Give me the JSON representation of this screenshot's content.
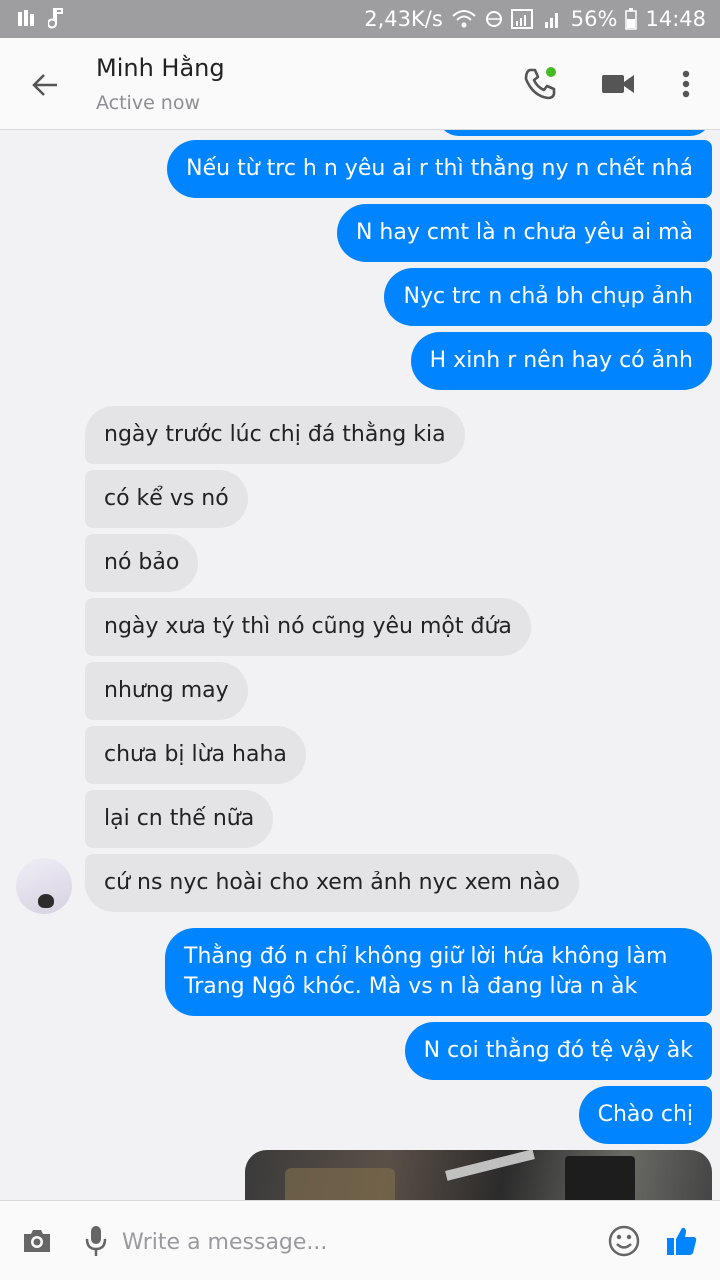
{
  "status_bar": {
    "speed": "2,43K/s",
    "battery": "56%",
    "time": "14:48"
  },
  "header": {
    "contact_name": "Minh Hằng",
    "contact_status": "Active now",
    "icons": [
      "back-arrow-icon",
      "phone-icon",
      "video-camera-icon",
      "more-vertical-icon"
    ]
  },
  "messages": [
    {
      "side": "out",
      "text": "Nếu từ trc h n yêu ai r thì thằng ny n chết nhá"
    },
    {
      "side": "out",
      "text": "N hay cmt là n chưa yêu ai mà"
    },
    {
      "side": "out",
      "text": "Nyc trc n chả bh chụp ảnh"
    },
    {
      "side": "out",
      "text": "H xinh r nên hay có ảnh"
    },
    {
      "side": "in",
      "text": "ngày trước lúc chị đá thằng kia"
    },
    {
      "side": "in",
      "text": "có kể vs nó"
    },
    {
      "side": "in",
      "text": "nó bảo"
    },
    {
      "side": "in",
      "text": "ngày xưa tý thì nó cũng yêu một đứa"
    },
    {
      "side": "in",
      "text": "nhưng may"
    },
    {
      "side": "in",
      "text": "chưa bị lừa haha"
    },
    {
      "side": "in",
      "text": "lại cn thế nữa"
    },
    {
      "side": "in",
      "text": "cứ ns nyc hoài cho xem ảnh nyc xem nào"
    },
    {
      "side": "out",
      "line1": "Thằng đó n chỉ không giữ lời hứa không làm",
      "line2": "Trang Ngô khóc. Mà vs n là đang lừa n àk"
    },
    {
      "side": "out",
      "text": "N coi thằng đó tệ vậy àk"
    },
    {
      "side": "out",
      "text": "Chào chị"
    }
  ],
  "composer": {
    "placeholder": "Write a message...",
    "icons": [
      "camera-icon",
      "microphone-icon",
      "emoji-icon",
      "thumbs-up-icon"
    ]
  },
  "colors": {
    "outgoing_bubble": "#0084ff",
    "incoming_bubble": "#e4e4e7",
    "accent": "#0084ff",
    "online_dot": "#44bb22"
  }
}
